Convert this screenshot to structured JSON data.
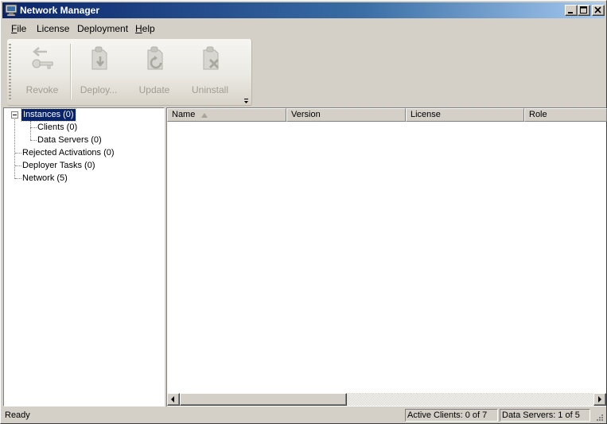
{
  "window": {
    "title": "Network Manager"
  },
  "menu": {
    "items": [
      {
        "label": "File",
        "mnemonic": "F",
        "rest": "ile"
      },
      {
        "label": "License",
        "mnemonic": "",
        "rest": "License"
      },
      {
        "label": "Deployment",
        "mnemonic": "",
        "rest": "Deployment"
      },
      {
        "label": "Help",
        "mnemonic": "H",
        "rest": "elp"
      }
    ]
  },
  "toolbar": {
    "buttons": [
      {
        "label": "Revoke",
        "icon": "revoke-key-icon",
        "enabled": false
      },
      {
        "label": "Deploy...",
        "icon": "deploy-icon",
        "enabled": false
      },
      {
        "label": "Update",
        "icon": "update-icon",
        "enabled": false
      },
      {
        "label": "Uninstall",
        "icon": "uninstall-icon",
        "enabled": false
      }
    ]
  },
  "tree": {
    "nodes": [
      {
        "label": "Instances (0)",
        "selected": true,
        "expanded": true
      },
      {
        "label": "Clients (0)"
      },
      {
        "label": "Data Servers (0)"
      },
      {
        "label": "Rejected Activations (0)"
      },
      {
        "label": "Deployer Tasks (0)"
      },
      {
        "label": "Network (5)"
      }
    ]
  },
  "list": {
    "columns": [
      {
        "label": "Name",
        "sorted": "ascending"
      },
      {
        "label": "Version"
      },
      {
        "label": "License"
      },
      {
        "label": "Role"
      }
    ],
    "rows": []
  },
  "statusbar": {
    "status": "Ready",
    "active_clients": "Active Clients: 0 of 7",
    "data_servers": "Data Servers: 1 of 5"
  },
  "colors": {
    "title_gradient_start": "#0a246a",
    "title_gradient_end": "#a6caf0",
    "selection": "#0a246a",
    "face": "#d4d0c8",
    "disabled_text": "#a19d94"
  }
}
